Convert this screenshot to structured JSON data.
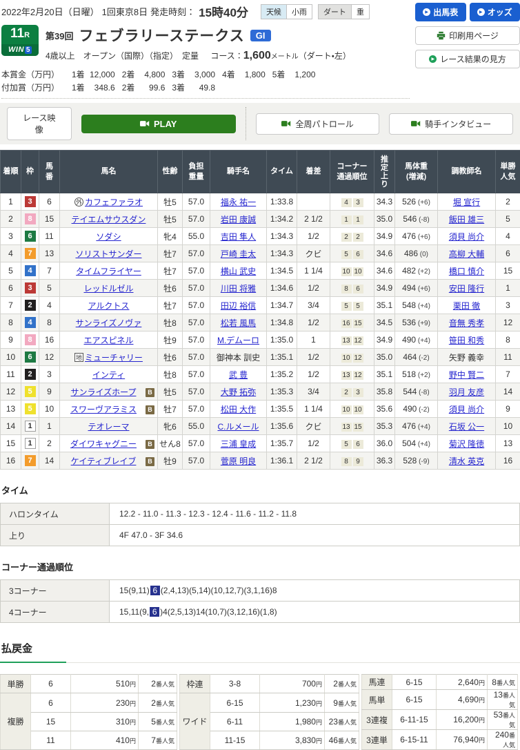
{
  "header": {
    "date_line": {
      "date": "2022年2月20日（日曜）",
      "meeting": "1回東京8日",
      "start_label": "発走時刻：",
      "start_time": "15時40分"
    },
    "weather": [
      {
        "label": "天候",
        "value": "小雨",
        "kind": "sky"
      },
      {
        "label": "ダート",
        "value": "重",
        "kind": "track"
      }
    ],
    "buttons": {
      "entries": "出馬表",
      "odds": "オッズ",
      "print": "印刷用ページ",
      "guide": "レース結果の見方"
    }
  },
  "race": {
    "race_no": "11",
    "race_no_suffix": "R",
    "win5_main": "WIN",
    "win5_num": "5",
    "edition": "第39回",
    "title": "フェブラリーステークス",
    "grade": "GI",
    "conditions": "4歳以上　オープン（国際）（指定）　定量",
    "course_label": "コース：",
    "course_value": "1,600",
    "course_unit": "メートル",
    "course_note": "（ダート・左）"
  },
  "prizes": {
    "main_label": "本賞金（万円）",
    "main": [
      [
        "1着",
        "12,000"
      ],
      [
        "2着",
        "4,800"
      ],
      [
        "3着",
        "3,000"
      ],
      [
        "4着",
        "1,800"
      ],
      [
        "5着",
        "1,200"
      ]
    ],
    "added_label": "付加賞（万円）",
    "added": [
      [
        "1着",
        "348.6"
      ],
      [
        "2着",
        "99.6"
      ],
      [
        "3着",
        "49.8"
      ]
    ]
  },
  "video": {
    "race_video": "レース映像",
    "play": "PLAY",
    "patrol": "全周パトロール",
    "interview": "騎手インタビュー"
  },
  "results": {
    "columns": [
      {
        "label": "着順"
      },
      {
        "label": "枠"
      },
      {
        "label": "馬\n番"
      },
      {
        "label": "馬名"
      },
      {
        "label": "性齢"
      },
      {
        "label": "負担\n重量"
      },
      {
        "label": "騎手名"
      },
      {
        "label": "タイム"
      },
      {
        "label": "着差"
      },
      {
        "label": "コーナー\n通過順位"
      },
      {
        "label": "推定上り",
        "vertical": true
      },
      {
        "label": "馬体重\n(増減)"
      },
      {
        "label": "調教師名"
      },
      {
        "label": "単勝\n人気"
      }
    ],
    "rows": [
      {
        "pos": "1",
        "frame": "3",
        "num": "6",
        "mark": {
          "shape": "circle",
          "char": "外"
        },
        "name": "カフェファラオ",
        "b": false,
        "sexage": "牡5",
        "weight": "57.0",
        "jockey": "福永 祐一",
        "jlink": true,
        "time": "1:33.8",
        "margin": "",
        "corner": [
          "4",
          "3"
        ],
        "last3f": "34.3",
        "hw": "526",
        "hwd": "(+6)",
        "trainer": "堀 宣行",
        "tlink": true,
        "pop": "2"
      },
      {
        "pos": "2",
        "frame": "8",
        "num": "15",
        "name": "テイエムサウスダン",
        "b": false,
        "sexage": "牡5",
        "weight": "57.0",
        "jockey": "岩田 康誠",
        "jlink": true,
        "time": "1:34.2",
        "margin": "2 1/2",
        "corner": [
          "1",
          "1"
        ],
        "last3f": "35.0",
        "hw": "546",
        "hwd": "(-8)",
        "trainer": "飯田 雄三",
        "tlink": true,
        "pop": "5"
      },
      {
        "pos": "3",
        "frame": "6",
        "num": "11",
        "name": "ソダシ",
        "b": false,
        "sexage": "牝4",
        "weight": "55.0",
        "jockey": "吉田 隼人",
        "jlink": true,
        "time": "1:34.3",
        "margin": "1/2",
        "corner": [
          "2",
          "2"
        ],
        "last3f": "34.9",
        "hw": "476",
        "hwd": "(+6)",
        "trainer": "須貝 尚介",
        "tlink": true,
        "pop": "4"
      },
      {
        "pos": "4",
        "frame": "7",
        "num": "13",
        "name": "ソリストサンダー",
        "b": false,
        "sexage": "牡7",
        "weight": "57.0",
        "jockey": "戸崎 圭太",
        "jlink": true,
        "time": "1:34.3",
        "margin": "クビ",
        "corner": [
          "5",
          "6"
        ],
        "last3f": "34.6",
        "hw": "486",
        "hwd": "(0)",
        "trainer": "高柳 大輔",
        "tlink": true,
        "pop": "6"
      },
      {
        "pos": "5",
        "frame": "4",
        "num": "7",
        "name": "タイムフライヤー",
        "b": false,
        "sexage": "牡7",
        "weight": "57.0",
        "jockey": "横山 武史",
        "jlink": true,
        "time": "1:34.5",
        "margin": "1 1/4",
        "corner": [
          "10",
          "10"
        ],
        "last3f": "34.6",
        "hw": "482",
        "hwd": "(+2)",
        "trainer": "橋口 慎介",
        "tlink": true,
        "pop": "15"
      },
      {
        "pos": "6",
        "frame": "3",
        "num": "5",
        "name": "レッドルゼル",
        "b": false,
        "sexage": "牡6",
        "weight": "57.0",
        "jockey": "川田 将雅",
        "jlink": true,
        "time": "1:34.6",
        "margin": "1/2",
        "corner": [
          "8",
          "6"
        ],
        "last3f": "34.9",
        "hw": "494",
        "hwd": "(+6)",
        "trainer": "安田 隆行",
        "tlink": true,
        "pop": "1"
      },
      {
        "pos": "7",
        "frame": "2",
        "num": "4",
        "name": "アルクトス",
        "b": false,
        "sexage": "牡7",
        "weight": "57.0",
        "jockey": "田辺 裕信",
        "jlink": true,
        "time": "1:34.7",
        "margin": "3/4",
        "corner": [
          "5",
          "5"
        ],
        "last3f": "35.1",
        "hw": "548",
        "hwd": "(+4)",
        "trainer": "栗田 徹",
        "tlink": true,
        "pop": "3"
      },
      {
        "pos": "8",
        "frame": "4",
        "num": "8",
        "name": "サンライズノヴァ",
        "b": false,
        "sexage": "牡8",
        "weight": "57.0",
        "jockey": "松若 風馬",
        "jlink": true,
        "time": "1:34.8",
        "margin": "1/2",
        "corner": [
          "16",
          "15"
        ],
        "last3f": "34.5",
        "hw": "536",
        "hwd": "(+9)",
        "trainer": "音無 秀孝",
        "tlink": true,
        "pop": "12"
      },
      {
        "pos": "9",
        "frame": "8",
        "num": "16",
        "name": "エアスピネル",
        "b": false,
        "sexage": "牡9",
        "weight": "57.0",
        "jockey": "M.デムーロ",
        "jlink": true,
        "time": "1:35.0",
        "margin": "1",
        "corner": [
          "13",
          "12"
        ],
        "last3f": "34.9",
        "hw": "490",
        "hwd": "(+4)",
        "trainer": "笹田 和秀",
        "tlink": true,
        "pop": "8"
      },
      {
        "pos": "10",
        "frame": "6",
        "num": "12",
        "mark": {
          "shape": "square",
          "char": "地"
        },
        "name": "ミューチャリー",
        "b": false,
        "sexage": "牡6",
        "weight": "57.0",
        "jockey": "御神本 訓史",
        "jlink": false,
        "time": "1:35.1",
        "margin": "1/2",
        "corner": [
          "10",
          "12"
        ],
        "last3f": "35.0",
        "hw": "464",
        "hwd": "(-2)",
        "trainer": "矢野 義幸",
        "tlink": false,
        "pop": "11"
      },
      {
        "pos": "11",
        "frame": "2",
        "num": "3",
        "name": "インティ",
        "b": false,
        "sexage": "牡8",
        "weight": "57.0",
        "jockey": "武 豊",
        "jlink": true,
        "time": "1:35.2",
        "margin": "1/2",
        "corner": [
          "13",
          "12"
        ],
        "last3f": "35.1",
        "hw": "518",
        "hwd": "(+2)",
        "trainer": "野中 賢二",
        "tlink": true,
        "pop": "7"
      },
      {
        "pos": "12",
        "frame": "5",
        "num": "9",
        "name": "サンライズホープ",
        "b": true,
        "sexage": "牡5",
        "weight": "57.0",
        "jockey": "大野 拓弥",
        "jlink": true,
        "time": "1:35.3",
        "margin": "3/4",
        "corner": [
          "2",
          "3"
        ],
        "last3f": "35.8",
        "hw": "544",
        "hwd": "(-8)",
        "trainer": "羽月 友彦",
        "tlink": true,
        "pop": "14"
      },
      {
        "pos": "13",
        "frame": "5",
        "num": "10",
        "name": "スワーヴアラミス",
        "b": true,
        "sexage": "牡7",
        "weight": "57.0",
        "jockey": "松田 大作",
        "jlink": true,
        "time": "1:35.5",
        "margin": "1 1/4",
        "corner": [
          "10",
          "10"
        ],
        "last3f": "35.6",
        "hw": "490",
        "hwd": "(-2)",
        "trainer": "須貝 尚介",
        "tlink": true,
        "pop": "9"
      },
      {
        "pos": "14",
        "frame": "1",
        "num": "1",
        "name": "テオレーマ",
        "b": false,
        "sexage": "牝6",
        "weight": "55.0",
        "jockey": "C.ルメール",
        "jlink": true,
        "time": "1:35.6",
        "margin": "クビ",
        "corner": [
          "13",
          "15"
        ],
        "last3f": "35.3",
        "hw": "476",
        "hwd": "(+4)",
        "trainer": "石坂 公一",
        "tlink": true,
        "pop": "10"
      },
      {
        "pos": "15",
        "frame": "1",
        "num": "2",
        "name": "ダイワキャグニー",
        "b": true,
        "sexage": "せん8",
        "weight": "57.0",
        "jockey": "三浦 皇成",
        "jlink": true,
        "time": "1:35.7",
        "margin": "1/2",
        "corner": [
          "5",
          "6"
        ],
        "last3f": "36.0",
        "hw": "504",
        "hwd": "(+4)",
        "trainer": "菊沢 隆徳",
        "tlink": true,
        "pop": "13"
      },
      {
        "pos": "16",
        "frame": "7",
        "num": "14",
        "name": "ケイティブレイブ",
        "b": true,
        "sexage": "牡9",
        "weight": "57.0",
        "jockey": "菅原 明良",
        "jlink": true,
        "time": "1:36.1",
        "margin": "2 1/2",
        "corner": [
          "8",
          "9"
        ],
        "last3f": "36.3",
        "hw": "528",
        "hwd": "(-9)",
        "trainer": "清水 英克",
        "tlink": true,
        "pop": "16"
      }
    ]
  },
  "time_section": {
    "heading": "タイム",
    "rows": [
      [
        "ハロンタイム",
        "12.2 - 11.0 - 11.3 - 12.3 - 12.4 - 11.6 - 11.2 - 11.8"
      ],
      [
        "上り",
        "4F 47.0 - 3F 34.6"
      ]
    ]
  },
  "corner_section": {
    "heading": "コーナー通過順位",
    "rows": [
      {
        "label": "3コーナー",
        "segments": [
          {
            "t": "15(9,11)"
          },
          {
            "t": "6",
            "hl": true
          },
          {
            "t": "(2,4,13)(5,14)(10,12,7)(3,1,16)8"
          }
        ]
      },
      {
        "label": "4コーナー",
        "segments": [
          {
            "t": "15,11(9,"
          },
          {
            "t": "6",
            "hl": true
          },
          {
            "t": ")4(2,5,13)14(10,7)(3,12,16)(1,8)"
          }
        ]
      }
    ]
  },
  "payout": {
    "heading": "払戻金",
    "yen": "円",
    "pop_suffix": "番人気",
    "groups": [
      [
        {
          "label": "単勝",
          "rows": [
            [
              "6",
              "510",
              "2"
            ]
          ]
        },
        {
          "label": "複勝",
          "rows": [
            [
              "6",
              "230",
              "2"
            ],
            [
              "15",
              "310",
              "5"
            ],
            [
              "11",
              "410",
              "7"
            ]
          ]
        }
      ],
      [
        {
          "label": "枠連",
          "rows": [
            [
              "3-8",
              "700",
              "2"
            ]
          ]
        },
        {
          "label": "ワイド",
          "rows": [
            [
              "6-15",
              "1,230",
              "9"
            ],
            [
              "6-11",
              "1,980",
              "23"
            ],
            [
              "11-15",
              "3,830",
              "46"
            ]
          ]
        }
      ],
      [
        {
          "label": "馬連",
          "rows": [
            [
              "6-15",
              "2,640",
              "8"
            ]
          ]
        },
        {
          "label": "馬単",
          "rows": [
            [
              "6-15",
              "4,690",
              "13"
            ]
          ]
        },
        {
          "label": "3連複",
          "rows": [
            [
              "6-11-15",
              "16,200",
              "53"
            ]
          ]
        },
        {
          "label": "3連単",
          "rows": [
            [
              "6-15-11",
              "76,940",
              "240"
            ]
          ]
        }
      ]
    ]
  },
  "colors": {
    "accent_green": "#1fa05a",
    "button_blue": "#1a5fd0",
    "header_slate": "#3f4a54",
    "highlight_navy": "#26318e"
  }
}
